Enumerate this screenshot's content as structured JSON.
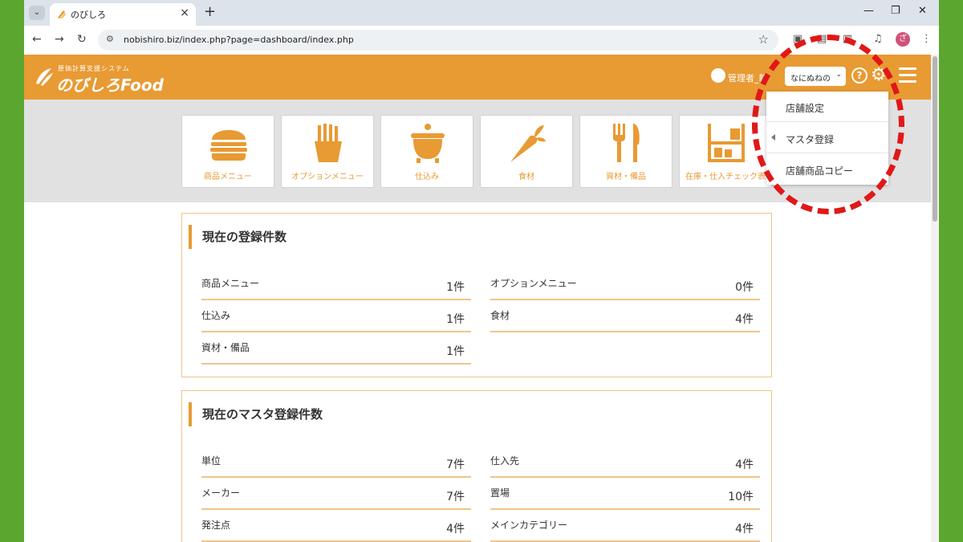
{
  "browser": {
    "tab_title": "のびしろ",
    "url": "nobishiro.biz/index.php?page=dashboard/index.php",
    "profile_initial": "ざ"
  },
  "header": {
    "logo_sub": "原価計算支援システム",
    "logo_text": "のびしろFood",
    "user_name": "管理者_新",
    "store_select": "なにぬねの",
    "brand_color": "#e89a33"
  },
  "nav_cards": [
    {
      "label": "商品メニュー",
      "icon": "hamburger-icon"
    },
    {
      "label": "オプションメニュー",
      "icon": "fries-icon"
    },
    {
      "label": "仕込み",
      "icon": "pot-icon"
    },
    {
      "label": "食材",
      "icon": "carrot-icon"
    },
    {
      "label": "資材・備品",
      "icon": "utensils-icon"
    },
    {
      "label": "在庫・仕入チェック表",
      "icon": "shelf-icon"
    }
  ],
  "dropdown": {
    "items": [
      "店舗設定",
      "マスタ登録",
      "店舗商品コピー"
    ]
  },
  "panel1": {
    "title": "現在の登録件数",
    "stats": [
      {
        "label": "商品メニュー",
        "value": "1件"
      },
      {
        "label": "オプションメニュー",
        "value": "0件"
      },
      {
        "label": "仕込み",
        "value": "1件"
      },
      {
        "label": "食材",
        "value": "4件"
      },
      {
        "label": "資材・備品",
        "value": "1件"
      }
    ]
  },
  "panel2": {
    "title": "現在のマスタ登録件数",
    "stats": [
      {
        "label": "単位",
        "value": "7件"
      },
      {
        "label": "仕入先",
        "value": "4件"
      },
      {
        "label": "メーカー",
        "value": "7件"
      },
      {
        "label": "置場",
        "value": "10件"
      },
      {
        "label": "発注点",
        "value": "4件"
      },
      {
        "label": "メインカテゴリー",
        "value": "4件"
      }
    ]
  }
}
